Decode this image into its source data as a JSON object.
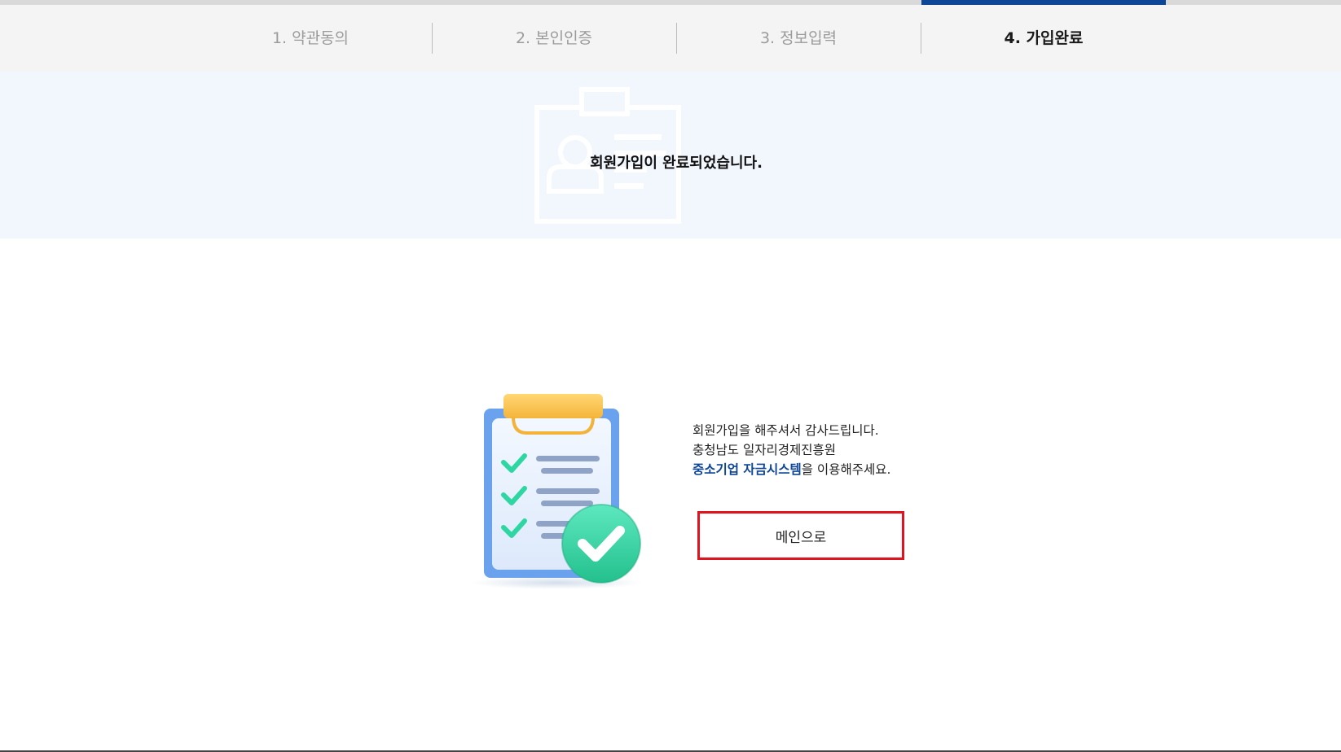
{
  "steps": {
    "items": [
      {
        "label": "1. 약관동의"
      },
      {
        "label": "2. 본인인증"
      },
      {
        "label": "3. 정보입력"
      },
      {
        "label": "4. 가입완료"
      }
    ],
    "current_step": 4,
    "total_steps": 4
  },
  "banner": {
    "title": "회원가입이 완료되었습니다.",
    "icon": "id-card-icon"
  },
  "message": {
    "line1": "회원가입을 해주셔서 감사드립니다.",
    "line2": "충청남도 일자리경제진흥원",
    "line3_highlight": "중소기업 자금시스템",
    "line3_rest": "을 이용해주세요."
  },
  "illustration": {
    "icon": "clipboard-checklist-icon"
  },
  "actions": {
    "main_label": "메인으로"
  },
  "colors": {
    "accent": "#0d4597",
    "button_border": "#e0141e",
    "banner_bg": "#f2f7fd",
    "check_green": "#3fd3a6"
  }
}
